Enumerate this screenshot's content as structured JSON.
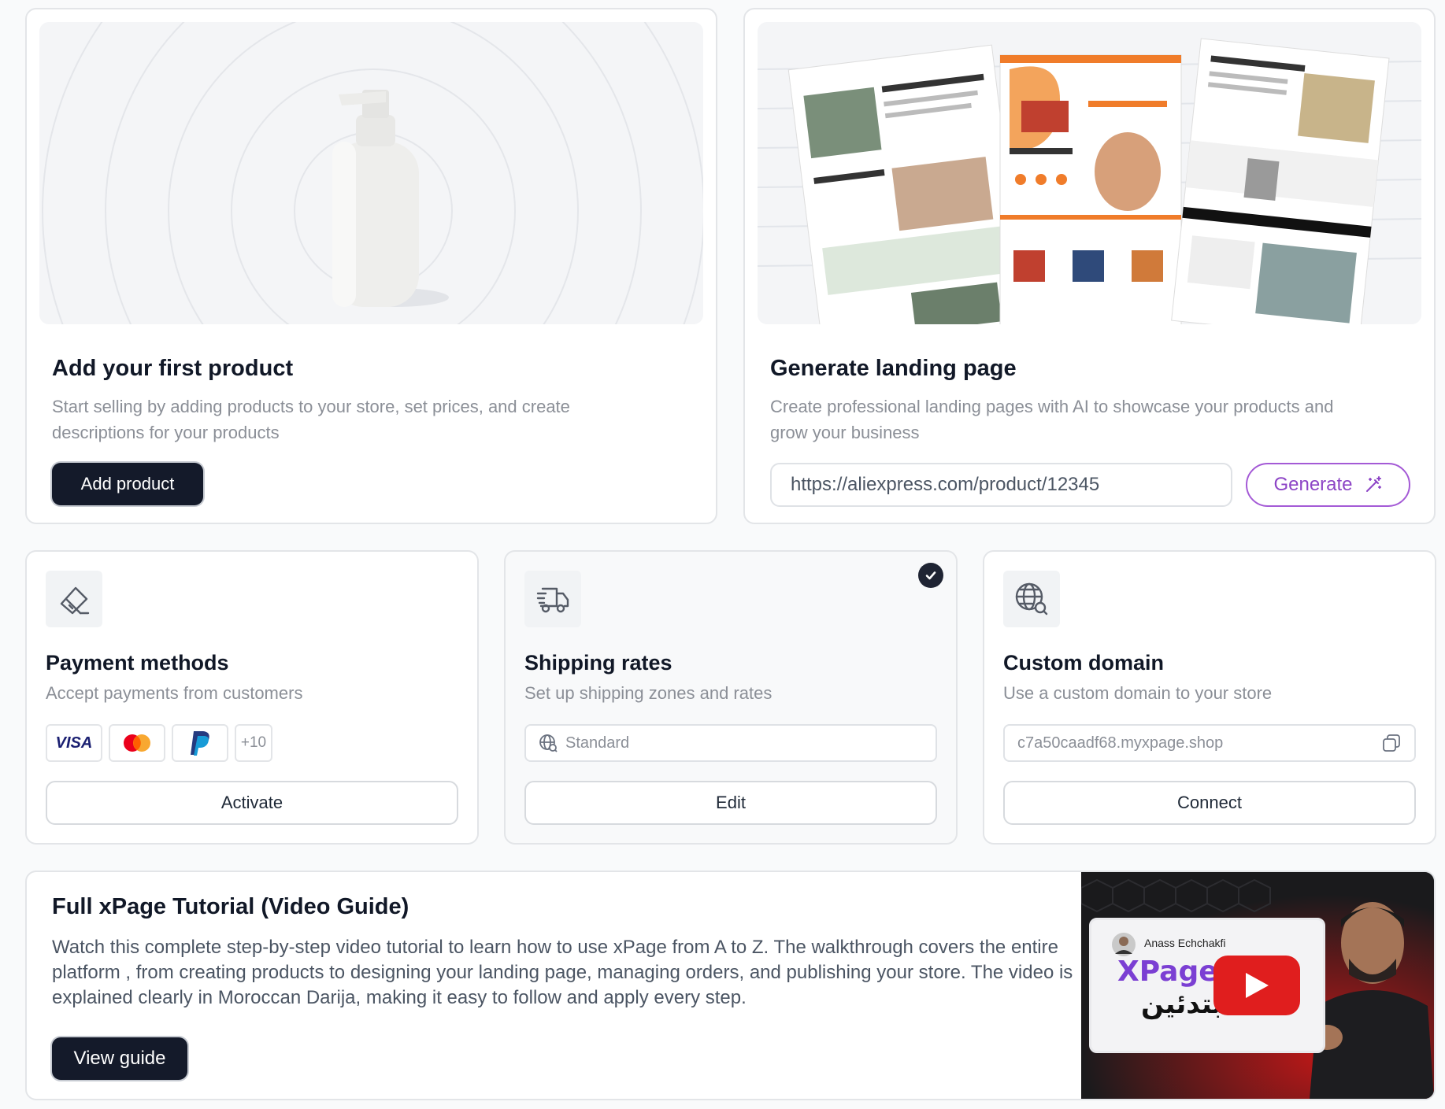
{
  "product_card": {
    "title": "Add your first product",
    "description": "Start selling by adding products to your store, set prices, and create descriptions for your products",
    "button_label": "Add product"
  },
  "landing_card": {
    "title": "Generate landing page",
    "description": "Create professional landing pages with AI to showcase your products and grow your business",
    "url_value": "https://aliexpress.com/product/12345",
    "button_label": "Generate",
    "button_icon": "magic-wand-icon"
  },
  "payment_card": {
    "icon": "payment-card-icon",
    "title": "Payment methods",
    "subtitle": "Accept payments from customers",
    "logos": [
      "visa",
      "mastercard",
      "paypal"
    ],
    "visa_label": "VISA",
    "more_label": "+10",
    "button_label": "Activate"
  },
  "shipping_card": {
    "icon": "delivery-truck-icon",
    "title": "Shipping rates",
    "subtitle": "Set up shipping zones and rates",
    "field_value": "Standard",
    "field_icon": "globe-icon",
    "completed": true,
    "button_label": "Edit"
  },
  "domain_card": {
    "icon": "globe-search-icon",
    "title": "Custom domain",
    "subtitle": "Use a custom domain to your store",
    "domain_value": "c7a50caadf68.myxpage.shop",
    "copy_icon": "copy-icon",
    "button_label": "Connect"
  },
  "tutorial_card": {
    "title": "Full xPage Tutorial (Video Guide)",
    "description": "Watch this complete step-by-step video tutorial to learn how to use xPage from A to Z. The walkthrough covers the entire platform , from creating products to designing your landing page, managing orders, and publishing your store. The video is explained clearly in Moroccan Darija, making it easy to follow and apply every step.",
    "button_label": "View guide",
    "video": {
      "channel_name": "Anass Echchakfi",
      "logo_text": "XPage",
      "arabic_text": "مبتدئين"
    }
  },
  "colors": {
    "dark_button": "#141a2a",
    "accent_purple": "#8d45c6",
    "muted_text": "#8b8f97",
    "border": "#e3e5e8"
  }
}
